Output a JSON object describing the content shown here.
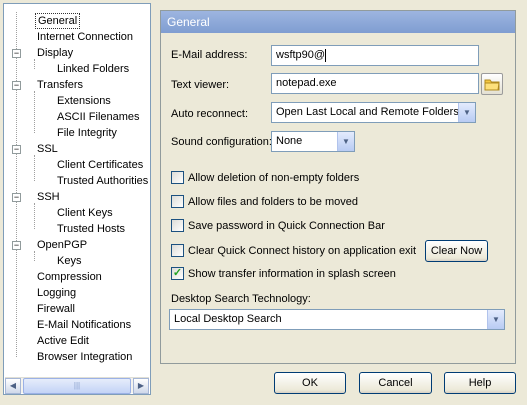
{
  "tree": {
    "items": [
      {
        "label": "General",
        "selected": true
      },
      {
        "label": "Internet Connection"
      },
      {
        "label": "Display",
        "expanded": true
      },
      {
        "label": "Linked Folders"
      },
      {
        "label": "Transfers",
        "expanded": true
      },
      {
        "label": "Extensions"
      },
      {
        "label": "ASCII Filenames"
      },
      {
        "label": "File Integrity"
      },
      {
        "label": "SSL",
        "expanded": true
      },
      {
        "label": "Client Certificates"
      },
      {
        "label": "Trusted Authorities"
      },
      {
        "label": "SSH",
        "expanded": true
      },
      {
        "label": "Client Keys"
      },
      {
        "label": "Trusted Hosts"
      },
      {
        "label": "OpenPGP",
        "expanded": true
      },
      {
        "label": "Keys"
      },
      {
        "label": "Compression"
      },
      {
        "label": "Logging"
      },
      {
        "label": "Firewall"
      },
      {
        "label": "E-Mail Notifications"
      },
      {
        "label": "Active Edit"
      },
      {
        "label": "Browser Integration"
      }
    ]
  },
  "panel": {
    "title": "General",
    "email_label": "E-Mail address:",
    "email_value": "wsftp90@",
    "viewer_label": "Text viewer:",
    "viewer_value": "notepad.exe",
    "reconnect_label": "Auto reconnect:",
    "reconnect_value": "Open Last Local and Remote Folders",
    "sound_label": "Sound configuration:",
    "sound_value": "None",
    "options": [
      {
        "label": "Allow deletion of non-empty folders",
        "checked": false
      },
      {
        "label": "Allow files and folders to be moved",
        "checked": false
      },
      {
        "label": "Save password in Quick Connection Bar",
        "checked": false
      },
      {
        "label": "Clear Quick Connect history on application exit",
        "checked": false
      },
      {
        "label": "Show transfer information in splash screen",
        "checked": true
      }
    ],
    "clear_now_label": "Clear Now",
    "search_label": "Desktop Search Technology:",
    "search_value": "Local Desktop Search"
  },
  "buttons": {
    "ok": "OK",
    "cancel": "Cancel",
    "help": "Help"
  }
}
